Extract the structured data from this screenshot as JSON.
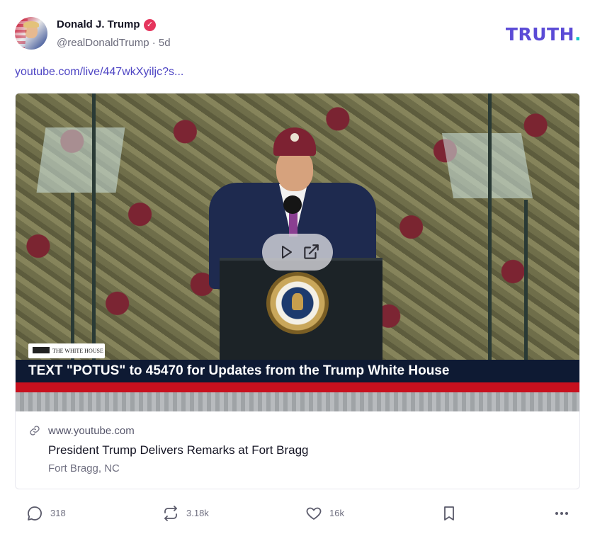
{
  "post": {
    "author": {
      "display_name": "Donald J. Trump",
      "verified_mark": "✓",
      "handle": "@realDonaldTrump",
      "separator": "·",
      "age": "5d"
    },
    "link_text": "youtube.com/live/447wkXyiljc?s...",
    "video": {
      "overlay_label": "THE WHITE HOUSE",
      "ticker_text": "TEXT \"POTUS\" to 45470 for Updates from the Trump White House",
      "play_icon": "play-icon",
      "open_icon": "external-link-icon"
    },
    "link_card": {
      "domain": "www.youtube.com",
      "title": "President Trump Delivers Remarks at Fort Bragg",
      "description": "Fort Bragg, NC"
    },
    "actions": {
      "replies": "318",
      "retruths": "3.18k",
      "likes": "16k"
    }
  },
  "brand": {
    "logo_text": "TRUTH",
    "logo_dot": ".",
    "logo_color": "#5b4bd6",
    "dot_color": "#10c6c8"
  },
  "colors": {
    "link": "#4f46c4",
    "verified_badge": "#e5355d",
    "ticker_bg": "#0e1a33",
    "ticker_stripe": "#c8101e"
  },
  "icons": {
    "reply": "comment-bubble-icon",
    "retruth": "repost-icon",
    "like": "heart-icon",
    "save": "bookmark-icon",
    "more": "more-horizontal-icon",
    "link": "link-chain-icon"
  }
}
